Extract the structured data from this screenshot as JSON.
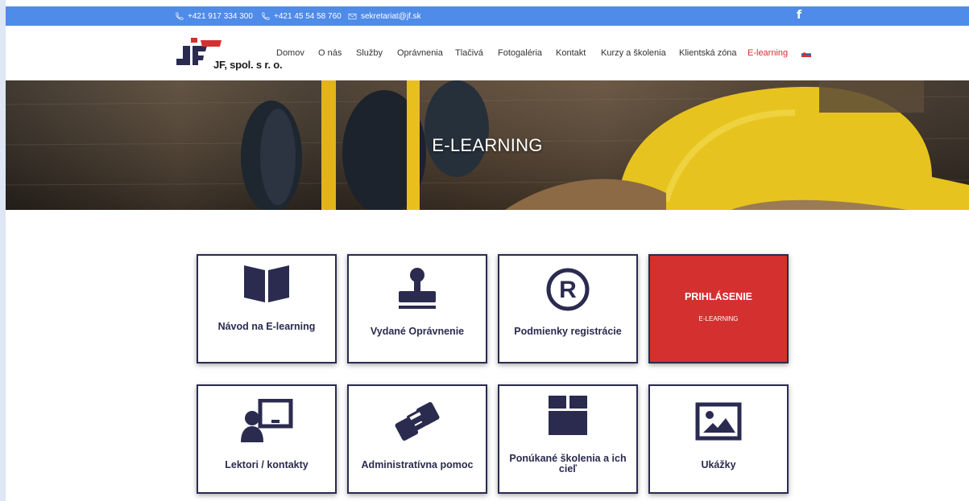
{
  "topbar": {
    "phone1": "+421 917 334 300",
    "phone2": "+421 45 54 58 760",
    "email": "sekretariat@jf.sk",
    "facebook": "f"
  },
  "logo": {
    "text": "JF, spol. s r. o."
  },
  "nav": [
    {
      "label": "Domov"
    },
    {
      "label": "O nás"
    },
    {
      "label": "Služby"
    },
    {
      "label": "Oprávnenia"
    },
    {
      "label": "Tlačivá"
    },
    {
      "label": "Fotogaléria"
    },
    {
      "label": "Kontakt"
    },
    {
      "label": "Kurzy a školenia"
    },
    {
      "label": "Klientská zóna"
    },
    {
      "label": "E-learning",
      "active": true
    }
  ],
  "hero": {
    "title": "E-LEARNING"
  },
  "tiles": [
    {
      "label": "Návod na E-learning",
      "icon": "book-icon"
    },
    {
      "label": "Vydané Oprávnenie",
      "icon": "stamp-icon"
    },
    {
      "label": "Podmienky registrácie",
      "icon": "registered-icon"
    },
    {
      "title": "PRIHLÁSENIE",
      "sub": "E-LEARNING"
    },
    {
      "label": "Lektori / kontakty",
      "icon": "lecturer-icon"
    },
    {
      "label": "Administratívna pomoc",
      "icon": "handshake-icon"
    },
    {
      "label": "Ponúkané školenia a ich cieľ",
      "icon": "box-icon"
    },
    {
      "label": "Ukážky",
      "icon": "image-icon"
    }
  ],
  "colors": {
    "navy": "#2a2b4f",
    "accent_red": "#d3302f",
    "topbar_blue": "#4f8be8"
  }
}
